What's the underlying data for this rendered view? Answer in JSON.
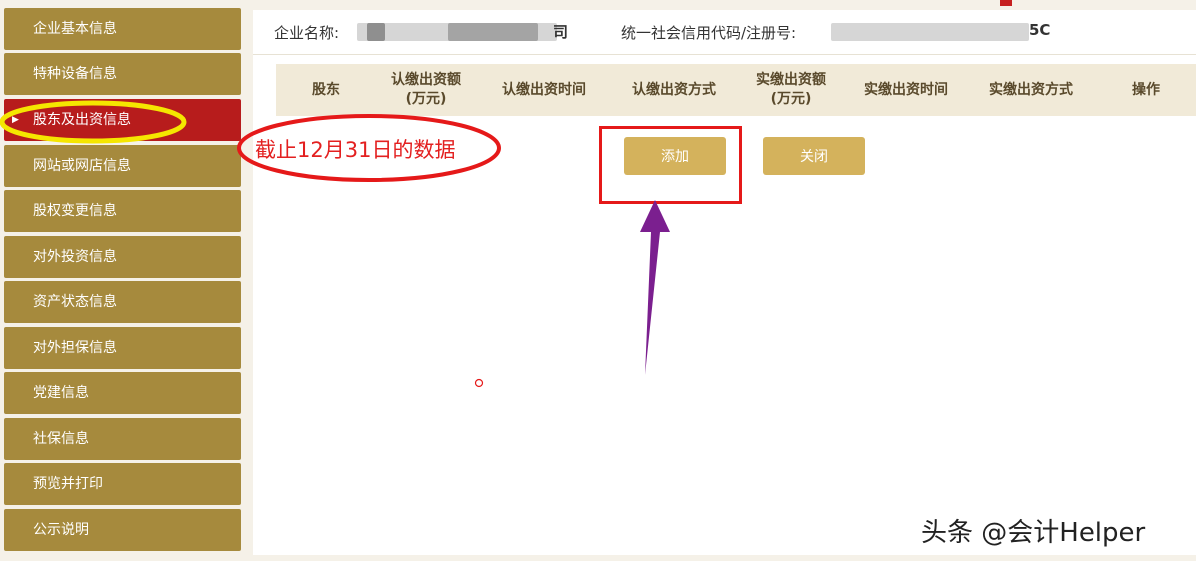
{
  "sidebar": {
    "items": [
      {
        "label": "企业基本信息"
      },
      {
        "label": "特种设备信息"
      },
      {
        "label": "股东及出资信息",
        "active": true
      },
      {
        "label": "网站或网店信息"
      },
      {
        "label": "股权变更信息"
      },
      {
        "label": "对外投资信息"
      },
      {
        "label": "资产状态信息"
      },
      {
        "label": "对外担保信息"
      },
      {
        "label": "党建信息"
      },
      {
        "label": "社保信息"
      },
      {
        "label": "预览并打印"
      },
      {
        "label": "公示说明"
      }
    ]
  },
  "info": {
    "company_label": "企业名称:",
    "company_value_tail": "司",
    "credit_label": "统一社会信用代码/注册号:",
    "credit_value_tail": "5C"
  },
  "table": {
    "headers": [
      "股东",
      "认缴出资额\n(万元)",
      "认缴出资时间",
      "认缴出资方式",
      "实缴出资额\n(万元)",
      "实缴出资时间",
      "实缴出资方式",
      "操作"
    ]
  },
  "buttons": {
    "add": "添加",
    "close": "关闭"
  },
  "annotation": {
    "note": "截止12月31日的数据",
    "highlight_color": "#f5e600",
    "circle_color": "#e51919",
    "arrow_color": "#7b1f8f"
  },
  "watermark": "头条 @会计Helper"
}
